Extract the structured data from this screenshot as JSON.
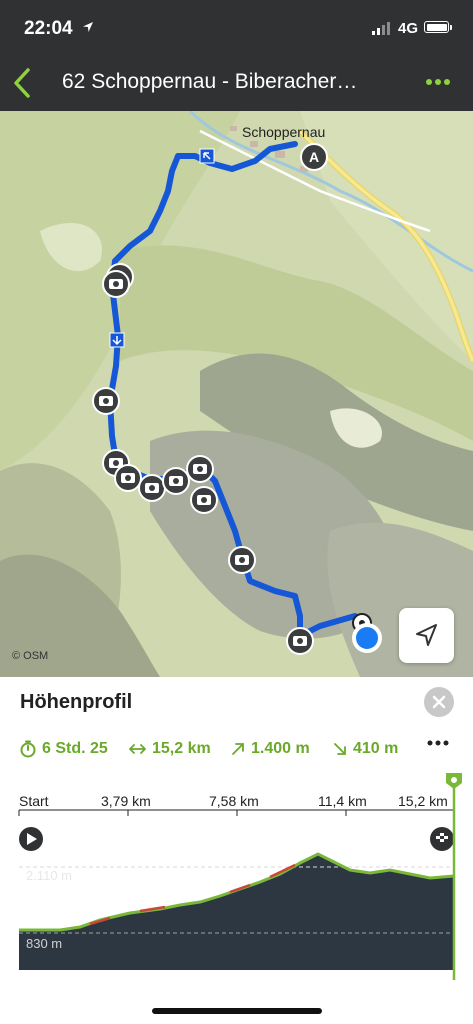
{
  "status_bar": {
    "time": "22:04",
    "network": "4G"
  },
  "header": {
    "title": "62 Schoppernau - Biberacher…"
  },
  "map": {
    "town": "Schoppernau",
    "start_marker": "A",
    "attribution": "© OSM"
  },
  "profile": {
    "title": "Höhenprofil",
    "stats": {
      "duration": "6 Std. 25",
      "distance": "15,2 km",
      "ascent": "1.400 m",
      "descent": "410 m"
    },
    "axis_labels": [
      "Start",
      "3,79 km",
      "7,58 km",
      "11,4 km",
      "15,2 km"
    ],
    "elevation_max": "2.110 m",
    "elevation_min": "830 m"
  },
  "colors": {
    "accent": "#6aa92a",
    "route": "#1557d6",
    "header_bg": "#2f3133",
    "profile_fill": "#2d3742"
  }
}
